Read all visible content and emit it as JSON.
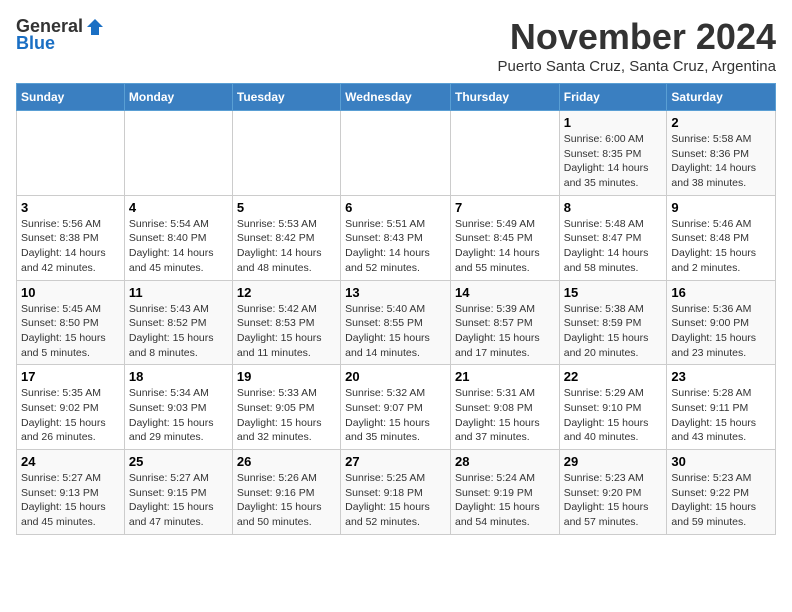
{
  "logo": {
    "general": "General",
    "blue": "Blue"
  },
  "title": "November 2024",
  "subtitle": "Puerto Santa Cruz, Santa Cruz, Argentina",
  "days_header": [
    "Sunday",
    "Monday",
    "Tuesday",
    "Wednesday",
    "Thursday",
    "Friday",
    "Saturday"
  ],
  "weeks": [
    [
      {
        "num": "",
        "info": ""
      },
      {
        "num": "",
        "info": ""
      },
      {
        "num": "",
        "info": ""
      },
      {
        "num": "",
        "info": ""
      },
      {
        "num": "",
        "info": ""
      },
      {
        "num": "1",
        "info": "Sunrise: 6:00 AM\nSunset: 8:35 PM\nDaylight: 14 hours\nand 35 minutes."
      },
      {
        "num": "2",
        "info": "Sunrise: 5:58 AM\nSunset: 8:36 PM\nDaylight: 14 hours\nand 38 minutes."
      }
    ],
    [
      {
        "num": "3",
        "info": "Sunrise: 5:56 AM\nSunset: 8:38 PM\nDaylight: 14 hours\nand 42 minutes."
      },
      {
        "num": "4",
        "info": "Sunrise: 5:54 AM\nSunset: 8:40 PM\nDaylight: 14 hours\nand 45 minutes."
      },
      {
        "num": "5",
        "info": "Sunrise: 5:53 AM\nSunset: 8:42 PM\nDaylight: 14 hours\nand 48 minutes."
      },
      {
        "num": "6",
        "info": "Sunrise: 5:51 AM\nSunset: 8:43 PM\nDaylight: 14 hours\nand 52 minutes."
      },
      {
        "num": "7",
        "info": "Sunrise: 5:49 AM\nSunset: 8:45 PM\nDaylight: 14 hours\nand 55 minutes."
      },
      {
        "num": "8",
        "info": "Sunrise: 5:48 AM\nSunset: 8:47 PM\nDaylight: 14 hours\nand 58 minutes."
      },
      {
        "num": "9",
        "info": "Sunrise: 5:46 AM\nSunset: 8:48 PM\nDaylight: 15 hours\nand 2 minutes."
      }
    ],
    [
      {
        "num": "10",
        "info": "Sunrise: 5:45 AM\nSunset: 8:50 PM\nDaylight: 15 hours\nand 5 minutes."
      },
      {
        "num": "11",
        "info": "Sunrise: 5:43 AM\nSunset: 8:52 PM\nDaylight: 15 hours\nand 8 minutes."
      },
      {
        "num": "12",
        "info": "Sunrise: 5:42 AM\nSunset: 8:53 PM\nDaylight: 15 hours\nand 11 minutes."
      },
      {
        "num": "13",
        "info": "Sunrise: 5:40 AM\nSunset: 8:55 PM\nDaylight: 15 hours\nand 14 minutes."
      },
      {
        "num": "14",
        "info": "Sunrise: 5:39 AM\nSunset: 8:57 PM\nDaylight: 15 hours\nand 17 minutes."
      },
      {
        "num": "15",
        "info": "Sunrise: 5:38 AM\nSunset: 8:59 PM\nDaylight: 15 hours\nand 20 minutes."
      },
      {
        "num": "16",
        "info": "Sunrise: 5:36 AM\nSunset: 9:00 PM\nDaylight: 15 hours\nand 23 minutes."
      }
    ],
    [
      {
        "num": "17",
        "info": "Sunrise: 5:35 AM\nSunset: 9:02 PM\nDaylight: 15 hours\nand 26 minutes."
      },
      {
        "num": "18",
        "info": "Sunrise: 5:34 AM\nSunset: 9:03 PM\nDaylight: 15 hours\nand 29 minutes."
      },
      {
        "num": "19",
        "info": "Sunrise: 5:33 AM\nSunset: 9:05 PM\nDaylight: 15 hours\nand 32 minutes."
      },
      {
        "num": "20",
        "info": "Sunrise: 5:32 AM\nSunset: 9:07 PM\nDaylight: 15 hours\nand 35 minutes."
      },
      {
        "num": "21",
        "info": "Sunrise: 5:31 AM\nSunset: 9:08 PM\nDaylight: 15 hours\nand 37 minutes."
      },
      {
        "num": "22",
        "info": "Sunrise: 5:29 AM\nSunset: 9:10 PM\nDaylight: 15 hours\nand 40 minutes."
      },
      {
        "num": "23",
        "info": "Sunrise: 5:28 AM\nSunset: 9:11 PM\nDaylight: 15 hours\nand 43 minutes."
      }
    ],
    [
      {
        "num": "24",
        "info": "Sunrise: 5:27 AM\nSunset: 9:13 PM\nDaylight: 15 hours\nand 45 minutes."
      },
      {
        "num": "25",
        "info": "Sunrise: 5:27 AM\nSunset: 9:15 PM\nDaylight: 15 hours\nand 47 minutes."
      },
      {
        "num": "26",
        "info": "Sunrise: 5:26 AM\nSunset: 9:16 PM\nDaylight: 15 hours\nand 50 minutes."
      },
      {
        "num": "27",
        "info": "Sunrise: 5:25 AM\nSunset: 9:18 PM\nDaylight: 15 hours\nand 52 minutes."
      },
      {
        "num": "28",
        "info": "Sunrise: 5:24 AM\nSunset: 9:19 PM\nDaylight: 15 hours\nand 54 minutes."
      },
      {
        "num": "29",
        "info": "Sunrise: 5:23 AM\nSunset: 9:20 PM\nDaylight: 15 hours\nand 57 minutes."
      },
      {
        "num": "30",
        "info": "Sunrise: 5:23 AM\nSunset: 9:22 PM\nDaylight: 15 hours\nand 59 minutes."
      }
    ]
  ]
}
